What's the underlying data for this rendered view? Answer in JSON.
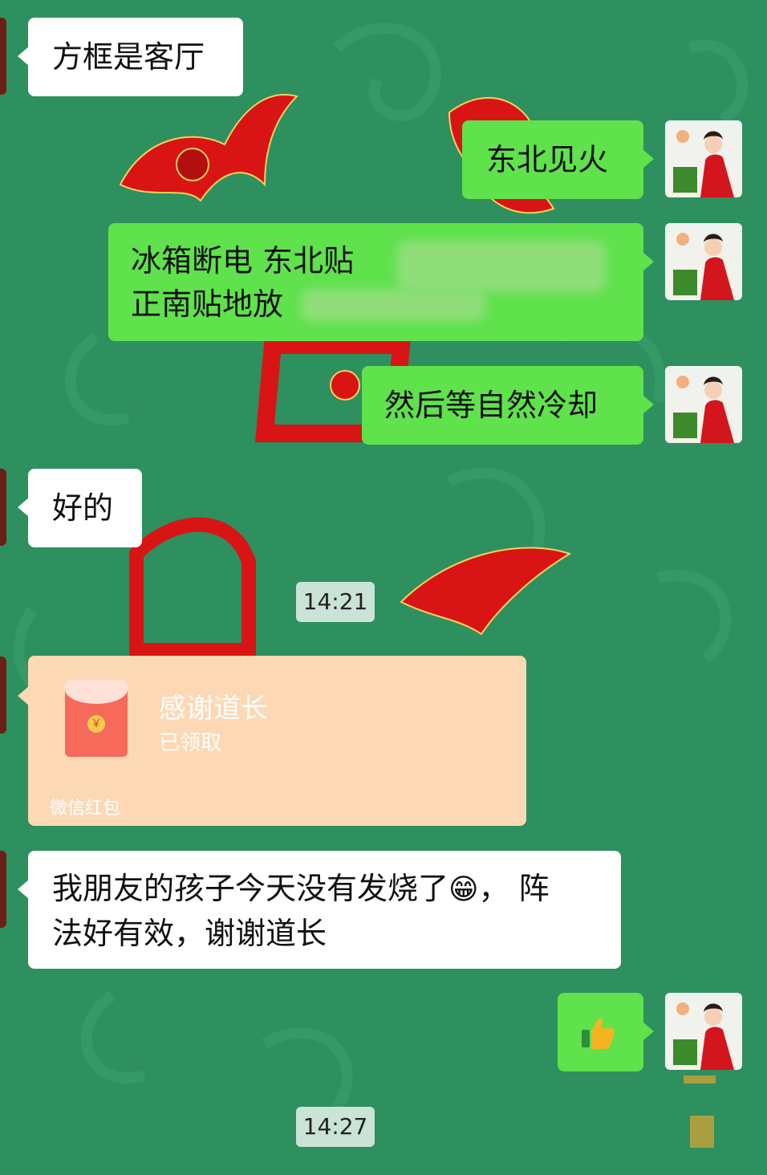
{
  "chat": {
    "messages": [
      {
        "side": "left",
        "text": "方框是客厅"
      },
      {
        "side": "right",
        "text": "东北见火"
      },
      {
        "side": "right",
        "line1": "冰箱断电  东北贴",
        "line2": "正南贴地放"
      },
      {
        "side": "right",
        "text": "然后等自然冷却"
      },
      {
        "side": "left",
        "text": "好的"
      },
      {
        "side": "left",
        "text1": "我朋友的孩子今天没有发烧了",
        "emoji": "😁",
        "text2": "，  阵",
        "line2": "法好有效，谢谢道长"
      },
      {
        "side": "right",
        "emoji": "👍"
      }
    ],
    "timestamps": [
      "14:21",
      "14:27"
    ],
    "red_packet": {
      "title": "感谢道长",
      "status": "已领取",
      "footer": "微信红包",
      "coin": "￥"
    }
  },
  "colors": {
    "background": "#2e8f5f",
    "bubble_right": "#5fe24c",
    "bubble_left": "#ffffff",
    "red_packet": "#fcd8b5"
  },
  "icons": [
    "avatar-icon",
    "red-packet-icon",
    "thumbs-up-icon",
    "grin-emoji-icon"
  ]
}
